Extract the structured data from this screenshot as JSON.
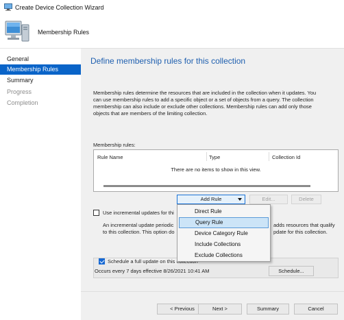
{
  "window": {
    "title": "Create Device Collection Wizard"
  },
  "header": {
    "page_title": "Membership Rules"
  },
  "sidebar": {
    "steps": [
      {
        "label": "General",
        "state": "normal"
      },
      {
        "label": "Membership Rules",
        "state": "active"
      },
      {
        "label": "Summary",
        "state": "normal"
      },
      {
        "label": "Progress",
        "state": "disabled"
      },
      {
        "label": "Completion",
        "state": "disabled"
      }
    ]
  },
  "main": {
    "title": "Define membership rules for this collection",
    "description": [
      "Membership rules determine the resources that are included in the collection when it updates. You",
      "can use membership rules to add a specific object or a set of objects from a query. The collection",
      "membership can also include or exclude other collections. Membership rules can add only those",
      "objects that are members of the limiting collection."
    ],
    "rules_label": "Membership rules:",
    "columns": [
      "Rule Name",
      "Type",
      "Collection Id"
    ],
    "empty_text": "There are no items to show in this view.",
    "add_rule_label": "Add Rule",
    "edit_label": "Edit...",
    "delete_label": "Delete",
    "incremental": {
      "label": "Use incremental updates for thi",
      "checked": false,
      "desc_left_1": "An incremental update periodic",
      "desc_left_2": "to this collection. This option do",
      "desc_right_1": "adds resources that qualify",
      "desc_right_2": "pdate for this collection."
    },
    "schedule": {
      "label": "Schedule a full update on this collection",
      "checked": true,
      "occurs": "Occurs every 7 days effective 8/26/2021 10:41 AM",
      "button_label": "Schedule..."
    }
  },
  "add_rule_menu": {
    "items": [
      "Direct Rule",
      "Query Rule",
      "Device Category Rule",
      "Include Collections",
      "Exclude Collections"
    ],
    "highlighted": "Query Rule"
  },
  "footer": {
    "previous_label": "< Previous",
    "next_label": "Next >",
    "summary_label": "Summary",
    "cancel_label": "Cancel"
  },
  "colors": {
    "accent": "#0a64c8",
    "title_blue": "#1e5faf",
    "menu_highlight": "#cce4f7"
  }
}
